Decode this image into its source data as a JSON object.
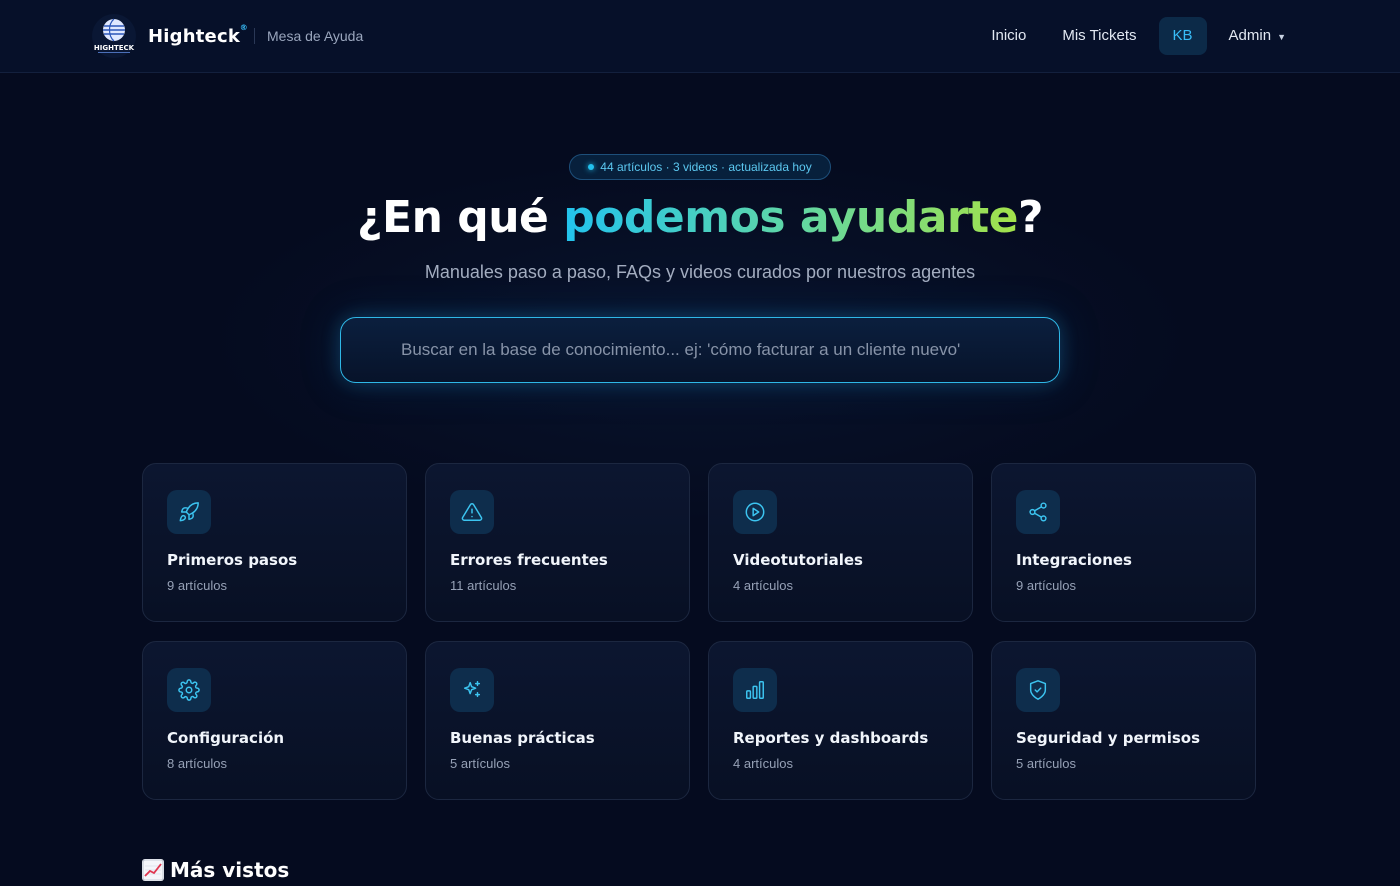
{
  "header": {
    "brand_name": "Highteck",
    "brand_reg": "®",
    "brand_subtitle": "Mesa de Ayuda",
    "logo_text": "HIGHTECK",
    "nav": [
      {
        "label": "Inicio"
      },
      {
        "label": "Mis Tickets"
      },
      {
        "label": "KB",
        "active": true
      },
      {
        "label": "Admin",
        "has_dropdown": true
      }
    ]
  },
  "hero": {
    "badge": "44 artículos · 3 videos · actualizada hoy",
    "title_prefix": "¿En qué ",
    "title_highlight": "podemos ayudarte",
    "title_suffix": "?",
    "subtitle": "Manuales paso a paso, FAQs y videos curados por nuestros agentes",
    "search_placeholder": "Buscar en la base de conocimiento... ej: 'cómo facturar a un cliente nuevo'"
  },
  "categories": [
    {
      "title": "Primeros pasos",
      "count": "9 artículos",
      "icon": "rocket-icon"
    },
    {
      "title": "Errores frecuentes",
      "count": "11 artículos",
      "icon": "warning-triangle-icon"
    },
    {
      "title": "Videotutoriales",
      "count": "4 artículos",
      "icon": "play-circle-icon"
    },
    {
      "title": "Integraciones",
      "count": "9 artículos",
      "icon": "share-nodes-icon"
    },
    {
      "title": "Configuración",
      "count": "8 artículos",
      "icon": "gear-icon"
    },
    {
      "title": "Buenas prácticas",
      "count": "5 artículos",
      "icon": "sparkles-icon"
    },
    {
      "title": "Reportes y dashboards",
      "count": "4 artículos",
      "icon": "bar-chart-icon"
    },
    {
      "title": "Seguridad y permisos",
      "count": "5 artículos",
      "icon": "shield-check-icon"
    }
  ],
  "most_viewed": {
    "title": "Más vistos",
    "icon": "chart-trend-icon"
  },
  "colors": {
    "background": "#050b1f",
    "accent": "#22c3ee",
    "accent_green": "#a3e24a"
  }
}
